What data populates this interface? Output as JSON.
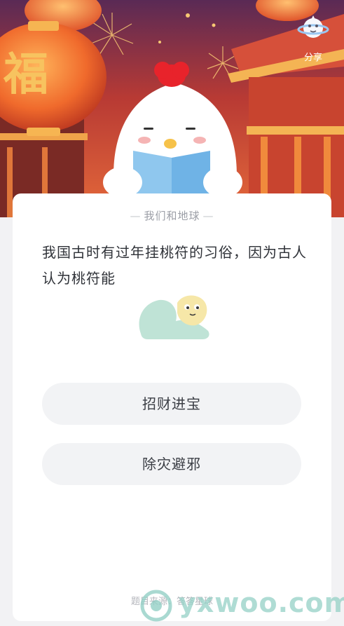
{
  "header": {
    "share_label": "分享",
    "share_icon": "planet-icon",
    "banner_character": "chicken-reading-book",
    "lantern_text": "福"
  },
  "quiz": {
    "category": "我们和地球",
    "question": "我国古时有过年挂桃符的习俗，因为古人认为桃符能",
    "options": [
      {
        "label": "招财进宝"
      },
      {
        "label": "除灾避邪"
      }
    ],
    "source": "题目来源：答答星球"
  },
  "watermark": {
    "text": "yxwoo.com"
  },
  "colors": {
    "banner_red": "#c23a2b",
    "banner_orange": "#f08a3c",
    "option_bg": "#f2f3f5",
    "page_bg": "#f2f2f4"
  }
}
